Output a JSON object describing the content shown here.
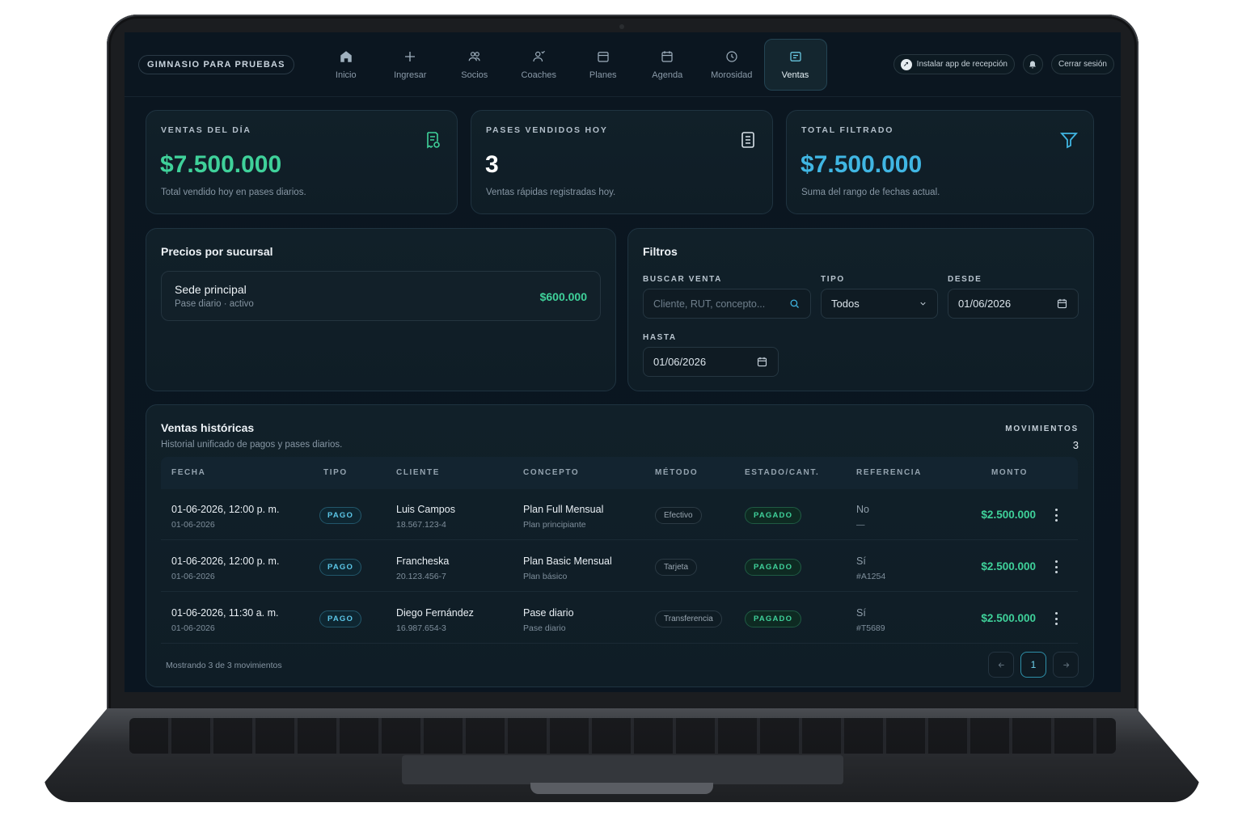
{
  "brand": "GIMNASIO PARA PRUEBAS",
  "nav": [
    {
      "label": "Inicio",
      "icon": "home-icon"
    },
    {
      "label": "Ingresar",
      "icon": "plus-icon"
    },
    {
      "label": "Socios",
      "icon": "users-icon"
    },
    {
      "label": "Coaches",
      "icon": "coach-icon"
    },
    {
      "label": "Planes",
      "icon": "plans-icon"
    },
    {
      "label": "Agenda",
      "icon": "calendar-icon"
    },
    {
      "label": "Morosidad",
      "icon": "clock-icon"
    },
    {
      "label": "Ventas",
      "icon": "sales-icon",
      "active": true
    }
  ],
  "top_actions": {
    "install_label": "Instalar app de recepción",
    "logout_label": "Cerrar sesión"
  },
  "stats": {
    "day_sales": {
      "label": "VENTAS DEL DÍA",
      "value": "$7.500.000",
      "sub": "Total vendido hoy en pases diarios."
    },
    "passes_sold": {
      "label": "PASES VENDIDOS HOY",
      "value": "3",
      "sub": "Ventas rápidas registradas hoy."
    },
    "filtered_total": {
      "label": "TOTAL FILTRADO",
      "value": "$7.500.000",
      "sub": "Suma del rango de fechas actual."
    }
  },
  "prices": {
    "title": "Precios por sucursal",
    "branch": {
      "name": "Sede principal",
      "detail": "Pase diario · activo",
      "price": "$600.000"
    }
  },
  "filters": {
    "title": "Filtros",
    "search_label": "BUSCAR VENTA",
    "search_placeholder": "Cliente, RUT, concepto...",
    "type_label": "TIPO",
    "type_value": "Todos",
    "from_label": "DESDE",
    "from_value": "01/06/2026",
    "to_label": "HASTA",
    "to_value": "01/06/2026"
  },
  "history": {
    "title": "Ventas históricas",
    "subtitle": "Historial unificado de pagos y pases diarios.",
    "movements_label": "MOVIMIENTOS",
    "movements_count": "3",
    "columns": [
      "FECHA",
      "TIPO",
      "CLIENTE",
      "CONCEPTO",
      "MÉTODO",
      "ESTADO/CANT.",
      "REFERENCIA",
      "MONTO"
    ],
    "rows": [
      {
        "date": "01-06-2026, 12:00 p. m.",
        "date_sub": "01-06-2026",
        "type": "PAGO",
        "client": "Luis Campos",
        "rut": "18.567.123-4",
        "concept": "Plan Full Mensual",
        "concept_sub": "Plan principiante",
        "method": "Efectivo",
        "status": "PAGADO",
        "ref": "No",
        "ref_sub": "—",
        "amount": "$2.500.000"
      },
      {
        "date": "01-06-2026, 12:00 p. m.",
        "date_sub": "01-06-2026",
        "type": "PAGO",
        "client": "Francheska",
        "rut": "20.123.456-7",
        "concept": "Plan Basic Mensual",
        "concept_sub": "Plan básico",
        "method": "Tarjeta",
        "status": "PAGADO",
        "ref": "Sí",
        "ref_sub": "#A1254",
        "amount": "$2.500.000"
      },
      {
        "date": "01-06-2026, 11:30 a. m.",
        "date_sub": "01-06-2026",
        "type": "PAGO",
        "client": "Diego Fernández",
        "rut": "16.987.654-3",
        "concept": "Pase diario",
        "concept_sub": "Pase diario",
        "method": "Transferencia",
        "status": "PAGADO",
        "ref": "Sí",
        "ref_sub": "#T5689",
        "amount": "$2.500.000"
      }
    ],
    "footer": "Mostrando 3 de 3 movimientos",
    "page": "1"
  }
}
